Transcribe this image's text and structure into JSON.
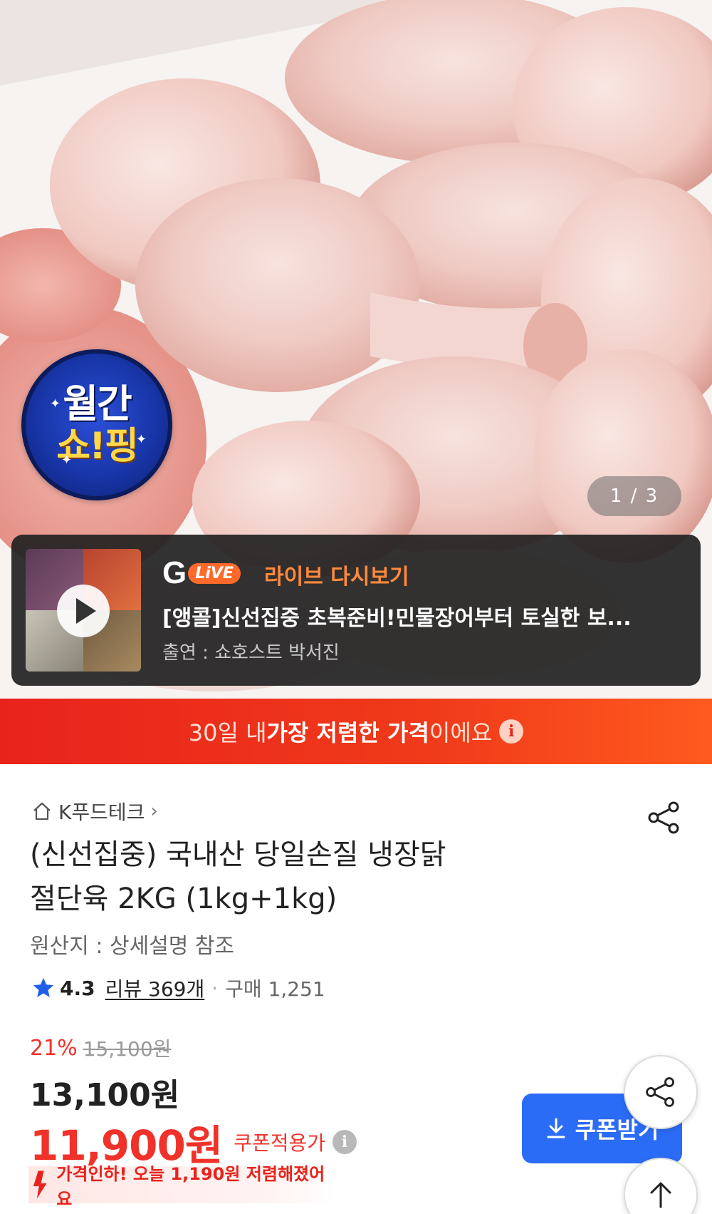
{
  "hero": {
    "badge_line1": "월간",
    "badge_line2": "쇼!핑",
    "image_counter": "1 / 3"
  },
  "live": {
    "logo_g": "G",
    "logo_live": "LiVE",
    "replay_label": "라이브 다시보기",
    "title": "[앵콜]신선집중 초복준비!민물장어부터 토실한 보...",
    "cast": "출연 : 쇼호스트 박서진"
  },
  "banner": {
    "pre": "30일 내 ",
    "strong": "가장 저렴한 가격",
    "post": "이에요",
    "info_glyph": "i"
  },
  "product": {
    "brand": "K푸드테크",
    "brand_chevron": "›",
    "title_line1": "(신선집중) 국내산 당일손질 냉장닭",
    "title_line2": "절단육 2KG (1kg+1kg)",
    "origin": "원산지 : 상세설명 참조",
    "rating": "4.3",
    "reviews": "리뷰 369개",
    "dot": "·",
    "purchases": "구매 1,251"
  },
  "price": {
    "discount_pct": "21%",
    "original": "15,100원",
    "sale": "13,100원",
    "coupon_price": "11,900원",
    "coupon_label": "쿠폰적용가",
    "info_glyph": "i",
    "drop_text": "가격인하! 오늘 1,190원 저렴해졌어요"
  },
  "actions": {
    "coupon_button": "쿠폰받기"
  },
  "colors": {
    "accent_red": "#f0322a",
    "banner_red": "#e8231c",
    "coupon_blue": "#2b6cf6",
    "live_orange": "#ff8a3d",
    "star_blue": "#1f5fe8"
  }
}
